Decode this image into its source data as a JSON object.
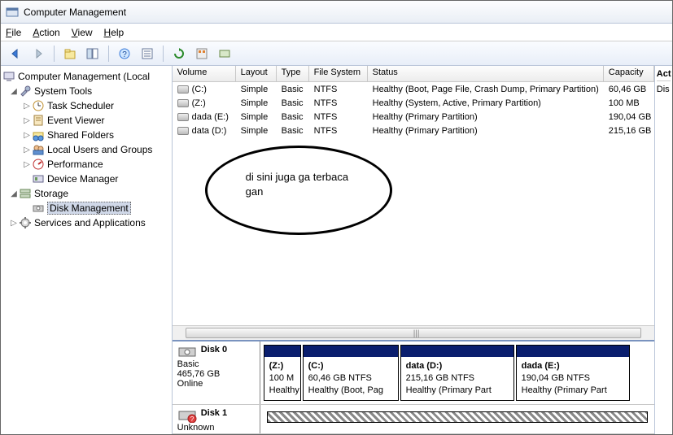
{
  "window": {
    "title": "Computer Management"
  },
  "menu": {
    "file": "File",
    "action": "Action",
    "view": "View",
    "help": "Help"
  },
  "tree": {
    "root": "Computer Management (Local",
    "systools": "System Tools",
    "tasksched": "Task Scheduler",
    "eventviewer": "Event Viewer",
    "sharedfolders": "Shared Folders",
    "localusers": "Local Users and Groups",
    "performance": "Performance",
    "devicemgr": "Device Manager",
    "storage": "Storage",
    "diskmgmt": "Disk Management",
    "services": "Services and Applications"
  },
  "vol_headers": {
    "volume": "Volume",
    "layout": "Layout",
    "type": "Type",
    "fs": "File System",
    "status": "Status",
    "capacity": "Capacity"
  },
  "volumes": [
    {
      "name": "(C:)",
      "layout": "Simple",
      "type": "Basic",
      "fs": "NTFS",
      "status": "Healthy (Boot, Page File, Crash Dump, Primary Partition)",
      "capacity": "60,46 GB"
    },
    {
      "name": "(Z:)",
      "layout": "Simple",
      "type": "Basic",
      "fs": "NTFS",
      "status": "Healthy (System, Active, Primary Partition)",
      "capacity": "100 MB"
    },
    {
      "name": "dada (E:)",
      "layout": "Simple",
      "type": "Basic",
      "fs": "NTFS",
      "status": "Healthy (Primary Partition)",
      "capacity": "190,04 GB"
    },
    {
      "name": "data (D:)",
      "layout": "Simple",
      "type": "Basic",
      "fs": "NTFS",
      "status": "Healthy (Primary Partition)",
      "capacity": "215,16 GB"
    }
  ],
  "annotation": {
    "line1": "di sini juga ga terbaca",
    "line2": "gan"
  },
  "disks": {
    "d0": {
      "title": "Disk 0",
      "type": "Basic",
      "size": "465,76 GB",
      "state": "Online"
    },
    "d0p0": {
      "name": "(Z:)",
      "l2": "100 M",
      "l3": "Healthy"
    },
    "d0p1": {
      "name": "(C:)",
      "l2": "60,46 GB NTFS",
      "l3": "Healthy (Boot, Pag"
    },
    "d0p2": {
      "name": "data  (D:)",
      "l2": "215,16 GB NTFS",
      "l3": "Healthy (Primary Part"
    },
    "d0p3": {
      "name": "dada  (E:)",
      "l2": "190,04 GB NTFS",
      "l3": "Healthy (Primary Part"
    },
    "d1": {
      "title": "Disk 1",
      "type": "Unknown"
    }
  },
  "rightpane": {
    "header": "Act",
    "item": "Dis"
  }
}
